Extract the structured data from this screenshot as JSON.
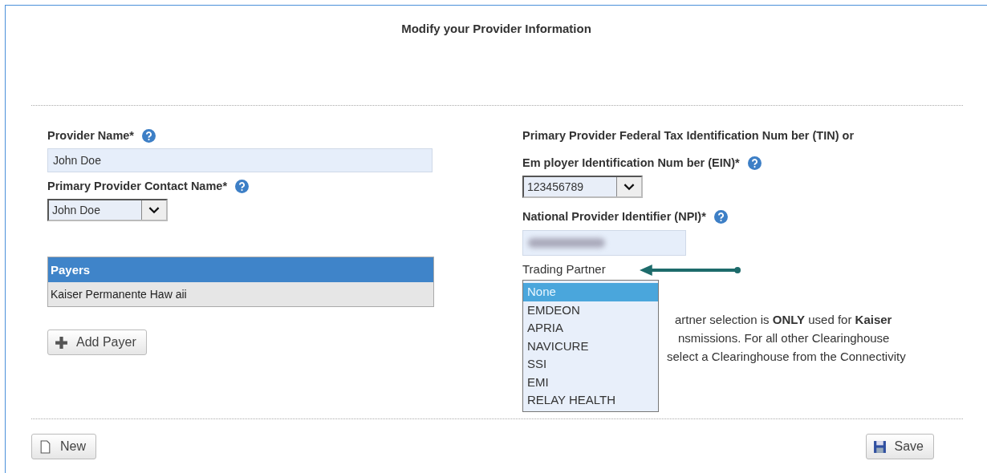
{
  "title": "Modify your Provider Information",
  "left": {
    "provider_name": {
      "label": "Provider Name*",
      "value": "John Doe"
    },
    "contact": {
      "label": "Primary Provider Contact Name*",
      "value": "John Doe"
    },
    "payers": {
      "header": "Payers",
      "rows": [
        "Kaiser Permanente Haw aii"
      ]
    },
    "add_button": "Add Payer"
  },
  "right": {
    "tin": {
      "label_lines": [
        "Primary Provider Federal Tax Identification Num ber (TIN) or",
        "Em ployer Identification Num ber (EIN)*"
      ],
      "value": "123456789"
    },
    "npi": {
      "label": "National Provider Identifier (NPI)*"
    },
    "trading_partner": {
      "label": "Trading Partner",
      "options": [
        {
          "label": "None",
          "selected": true
        },
        {
          "label": "EMDEON",
          "selected": false
        },
        {
          "label": "APRIA",
          "selected": false
        },
        {
          "label": "NAVICURE",
          "selected": false
        },
        {
          "label": "SSI",
          "selected": false
        },
        {
          "label": "EMI",
          "selected": false
        },
        {
          "label": "RELAY HEALTH",
          "selected": false
        }
      ]
    },
    "note_lines": [
      "artner selection is **ONLY** used for **Kaiser**",
      "nsmissions. For all other Clearinghouse",
      "select a Clearinghouse from the Connectivity"
    ]
  },
  "footer": {
    "new_button": "New",
    "save_button": "Save"
  }
}
